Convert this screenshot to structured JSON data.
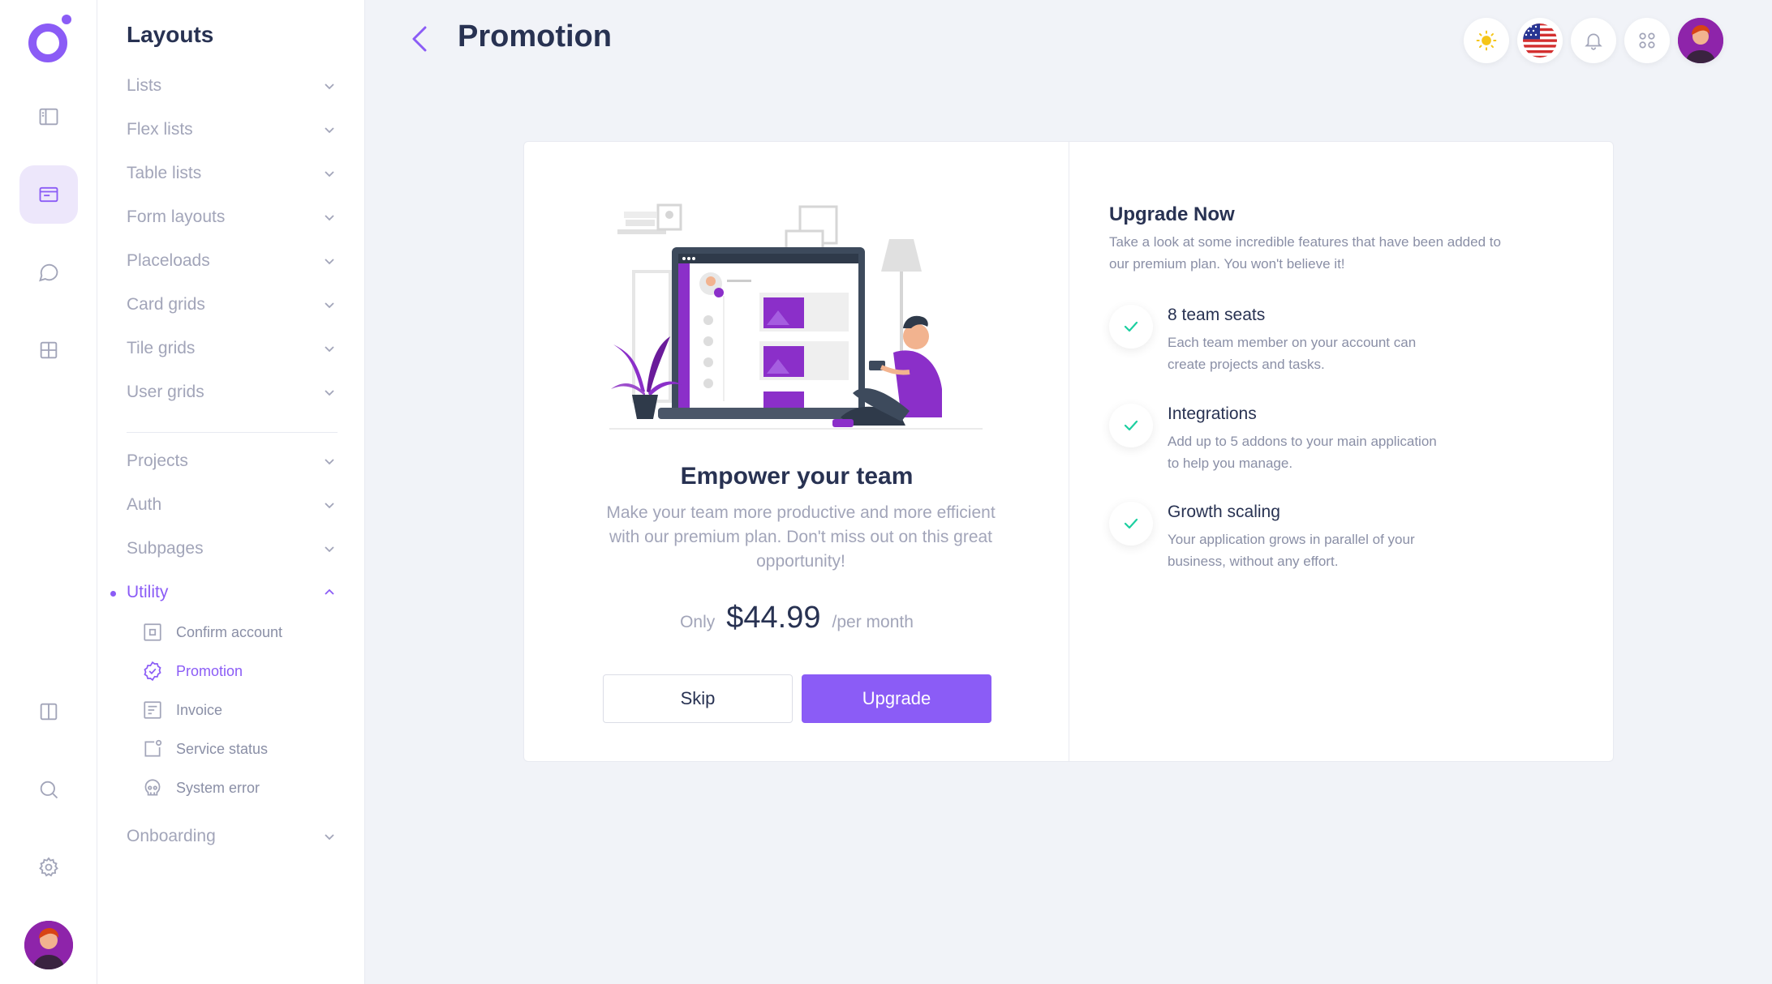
{
  "sidebar": {
    "title": "Layouts",
    "groups_top": [
      {
        "label": "Lists"
      },
      {
        "label": "Flex lists"
      },
      {
        "label": "Table lists"
      },
      {
        "label": "Form layouts"
      },
      {
        "label": "Placeloads"
      },
      {
        "label": "Card grids"
      },
      {
        "label": "Tile grids"
      },
      {
        "label": "User grids"
      }
    ],
    "groups_bottom": [
      {
        "label": "Projects"
      },
      {
        "label": "Auth"
      },
      {
        "label": "Subpages"
      },
      {
        "label": "Utility"
      }
    ],
    "utility_items": [
      {
        "label": "Confirm account",
        "icon": "confirm-account-icon"
      },
      {
        "label": "Promotion",
        "icon": "promotion-badge-icon"
      },
      {
        "label": "Invoice",
        "icon": "invoice-icon"
      },
      {
        "label": "Service status",
        "icon": "service-status-icon"
      },
      {
        "label": "System error",
        "icon": "system-error-icon"
      }
    ],
    "onboarding": {
      "label": "Onboarding"
    }
  },
  "header": {
    "title": "Promotion"
  },
  "promo": {
    "heading": "Empower your team",
    "description": "Make your team more productive and more efficient with our premium plan. Don't miss out on this great opportunity!",
    "price_prefix": "Only",
    "price": "$44.99",
    "price_period": "/per month",
    "skip_label": "Skip",
    "upgrade_label": "Upgrade"
  },
  "upgrade": {
    "title": "Upgrade Now",
    "subtitle": "Take a look at some incredible features that have been added to our premium plan. You won't believe it!",
    "features": [
      {
        "title": "8 team seats",
        "description": "Each team member on your account can create projects and tasks."
      },
      {
        "title": "Integrations",
        "description": "Add up to 5 addons to your main application to help you manage."
      },
      {
        "title": "Growth scaling",
        "description": "Your application grows in parallel of your business, without any effort."
      }
    ]
  },
  "colors": {
    "accent": "#8b5cf6",
    "success": "#1ccfa0",
    "muted": "#a2a5b9",
    "heading": "#283252",
    "background": "#f1f3f8"
  }
}
